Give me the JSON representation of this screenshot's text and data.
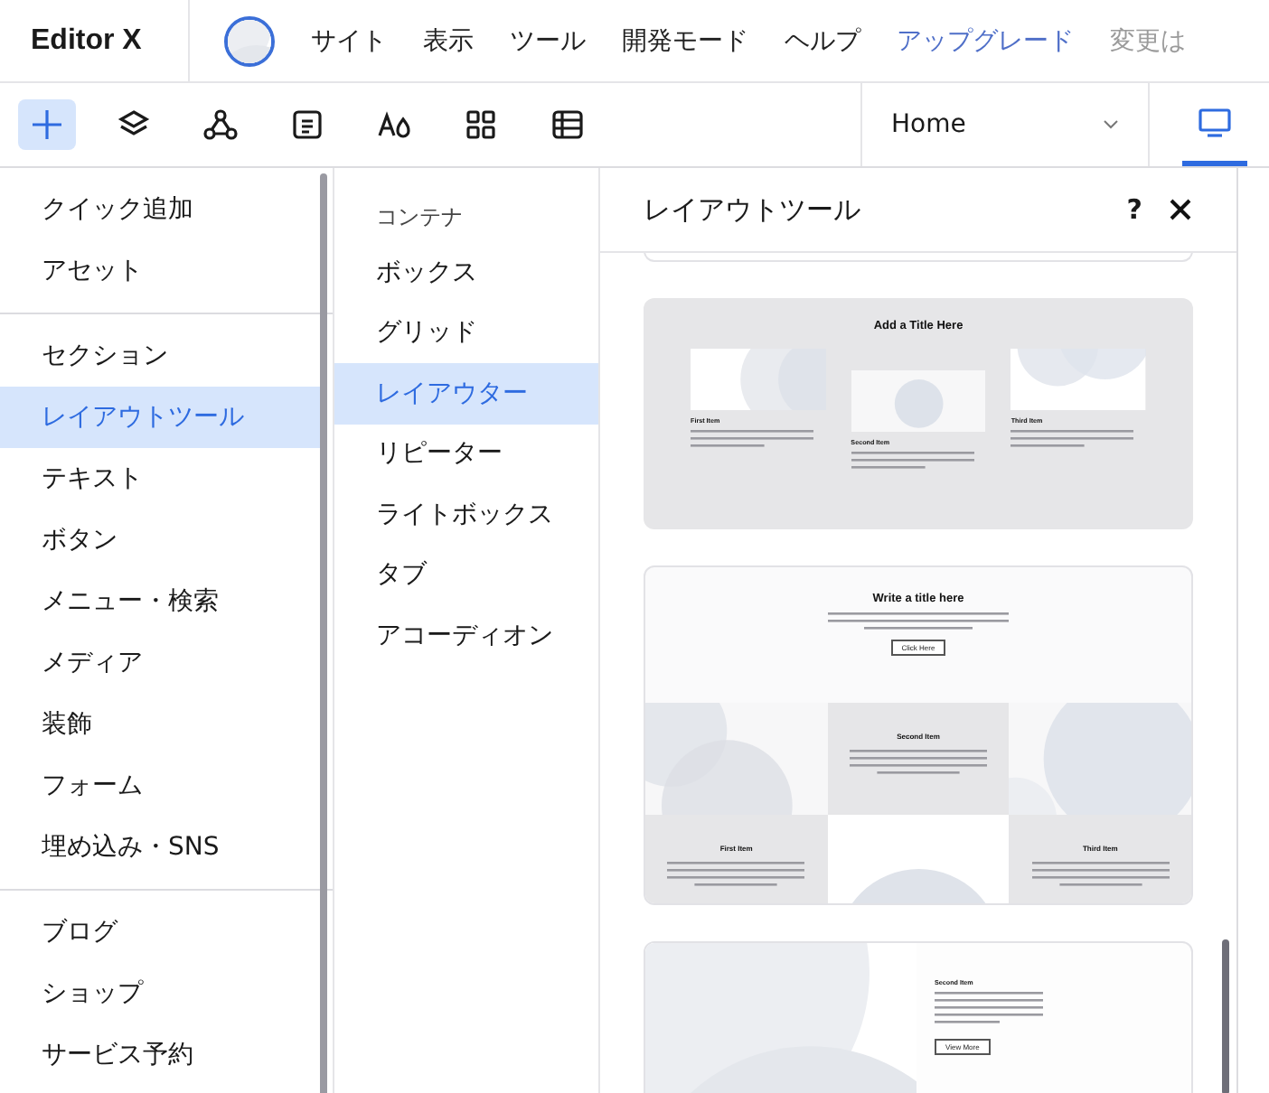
{
  "app": {
    "logo": "Editor X"
  },
  "menu": [
    {
      "label": "サイト",
      "kind": "normal"
    },
    {
      "label": "表示",
      "kind": "normal"
    },
    {
      "label": "ツール",
      "kind": "normal"
    },
    {
      "label": "開発モード",
      "kind": "normal"
    },
    {
      "label": "ヘルプ",
      "kind": "normal"
    },
    {
      "label": "アップグレード",
      "kind": "upgrade"
    },
    {
      "label": "変更は",
      "kind": "muted"
    }
  ],
  "tools": [
    {
      "kind": "add",
      "selected": true
    },
    {
      "kind": "layers",
      "selected": false
    },
    {
      "kind": "connect",
      "selected": false
    },
    {
      "kind": "pages",
      "selected": false
    },
    {
      "kind": "theme",
      "selected": false
    },
    {
      "kind": "apps",
      "selected": false
    },
    {
      "kind": "table",
      "selected": false
    }
  ],
  "page_select": {
    "value": "Home"
  },
  "devices": [
    {
      "kind": "desktop",
      "selected": true
    }
  ],
  "category_groups": [
    {
      "items": [
        {
          "label": "クイック追加",
          "selected": false
        },
        {
          "label": "アセット",
          "selected": false
        }
      ]
    },
    {
      "items": [
        {
          "label": "セクション",
          "selected": false
        },
        {
          "label": "レイアウトツール",
          "selected": true
        },
        {
          "label": "テキスト",
          "selected": false
        },
        {
          "label": "ボタン",
          "selected": false
        },
        {
          "label": "メニュー・検索",
          "selected": false
        },
        {
          "label": "メディア",
          "selected": false
        },
        {
          "label": "装飾",
          "selected": false
        },
        {
          "label": "フォーム",
          "selected": false
        },
        {
          "label": "埋め込み・SNS",
          "selected": false
        }
      ]
    },
    {
      "items": [
        {
          "label": "ブログ",
          "selected": false
        },
        {
          "label": "ショップ",
          "selected": false
        },
        {
          "label": "サービス予約",
          "selected": false
        }
      ]
    }
  ],
  "subcategories": {
    "heading": "コンテナ",
    "items": [
      {
        "label": "ボックス",
        "selected": false
      },
      {
        "label": "グリッド",
        "selected": false
      },
      {
        "label": "レイアウター",
        "selected": true
      },
      {
        "label": "リピーター",
        "selected": false
      },
      {
        "label": "ライトボックス",
        "selected": false
      },
      {
        "label": "タブ",
        "selected": false
      },
      {
        "label": "アコーディオン",
        "selected": false
      }
    ]
  },
  "panel": {
    "title": "レイアウトツール",
    "help": "?",
    "presets": [
      {
        "kind": "columns",
        "title": "Add a Title Here",
        "items": [
          {
            "title": "First Item"
          },
          {
            "title": "Second Item"
          },
          {
            "title": "Third Item"
          }
        ]
      },
      {
        "kind": "grid",
        "title": "Write a title here",
        "button": "Click Here",
        "items": [
          {
            "title": "Second Item"
          },
          {
            "title": "First Item"
          },
          {
            "title": "Third Item"
          }
        ]
      },
      {
        "kind": "split",
        "title": "Second Item",
        "button": "View More"
      }
    ]
  }
}
